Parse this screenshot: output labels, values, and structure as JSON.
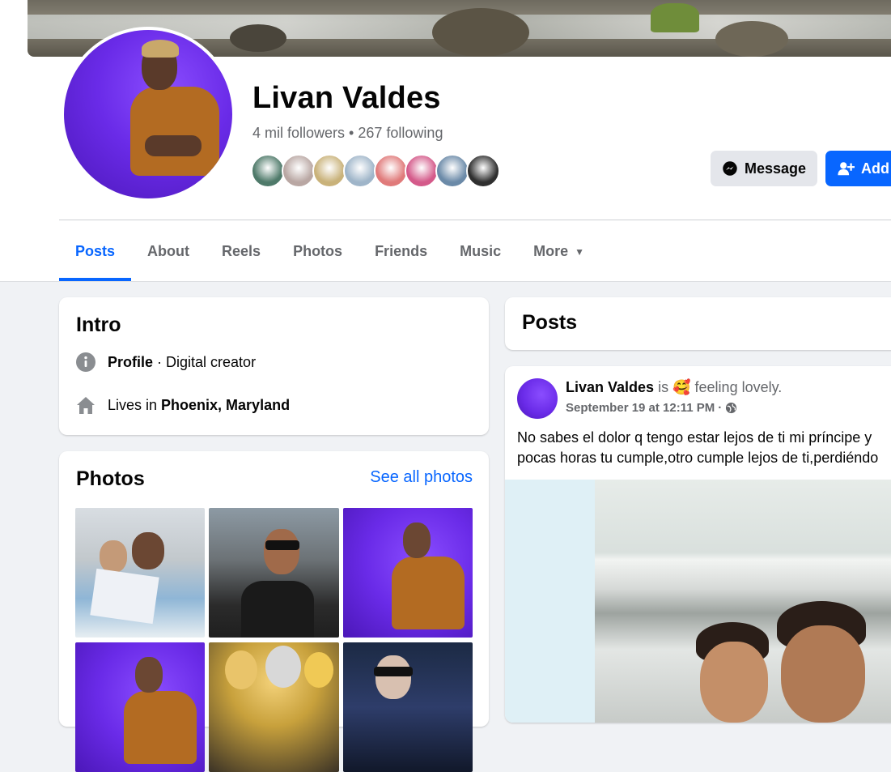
{
  "profile": {
    "name": "Livan Valdes",
    "followers": "4 mil followers",
    "separator": "•",
    "following": "267 following",
    "friend_avatar_colors": [
      "#4f7a6a",
      "#b9a7a3",
      "#c9b27a",
      "#9fb5c9",
      "#e07a7a",
      "#d45a8a",
      "#6b8aa8",
      "#2f2f2f"
    ]
  },
  "actions": {
    "message_label": "Message",
    "add_label": "Add"
  },
  "tabs": [
    {
      "label": "Posts"
    },
    {
      "label": "About"
    },
    {
      "label": "Reels"
    },
    {
      "label": "Photos"
    },
    {
      "label": "Friends"
    },
    {
      "label": "Music"
    },
    {
      "label": "More"
    }
  ],
  "intro": {
    "title": "Intro",
    "profile_label": "Profile",
    "profile_sep": "·",
    "profile_value": "Digital creator",
    "lives_prefix": "Lives in",
    "lives_place": "Phoenix, Maryland"
  },
  "photos": {
    "title": "Photos",
    "see_all": "See all photos"
  },
  "posts": {
    "title": "Posts",
    "post": {
      "author": "Livan Valdes",
      "is_text": "is",
      "feeling_emoji": "🥰",
      "feeling_text": "feeling lovely.",
      "timestamp": "September 19 at 12:11 PM",
      "dot": "·",
      "text_line1": "No sabes el dolor q tengo  estar lejos de ti mi príncipe y",
      "text_line2": "pocas horas tu cumple,otro cumple lejos de ti,perdiéndo"
    }
  },
  "colors": {
    "accent": "#0866ff",
    "background": "#f0f2f5",
    "muted_text": "#65676b"
  }
}
